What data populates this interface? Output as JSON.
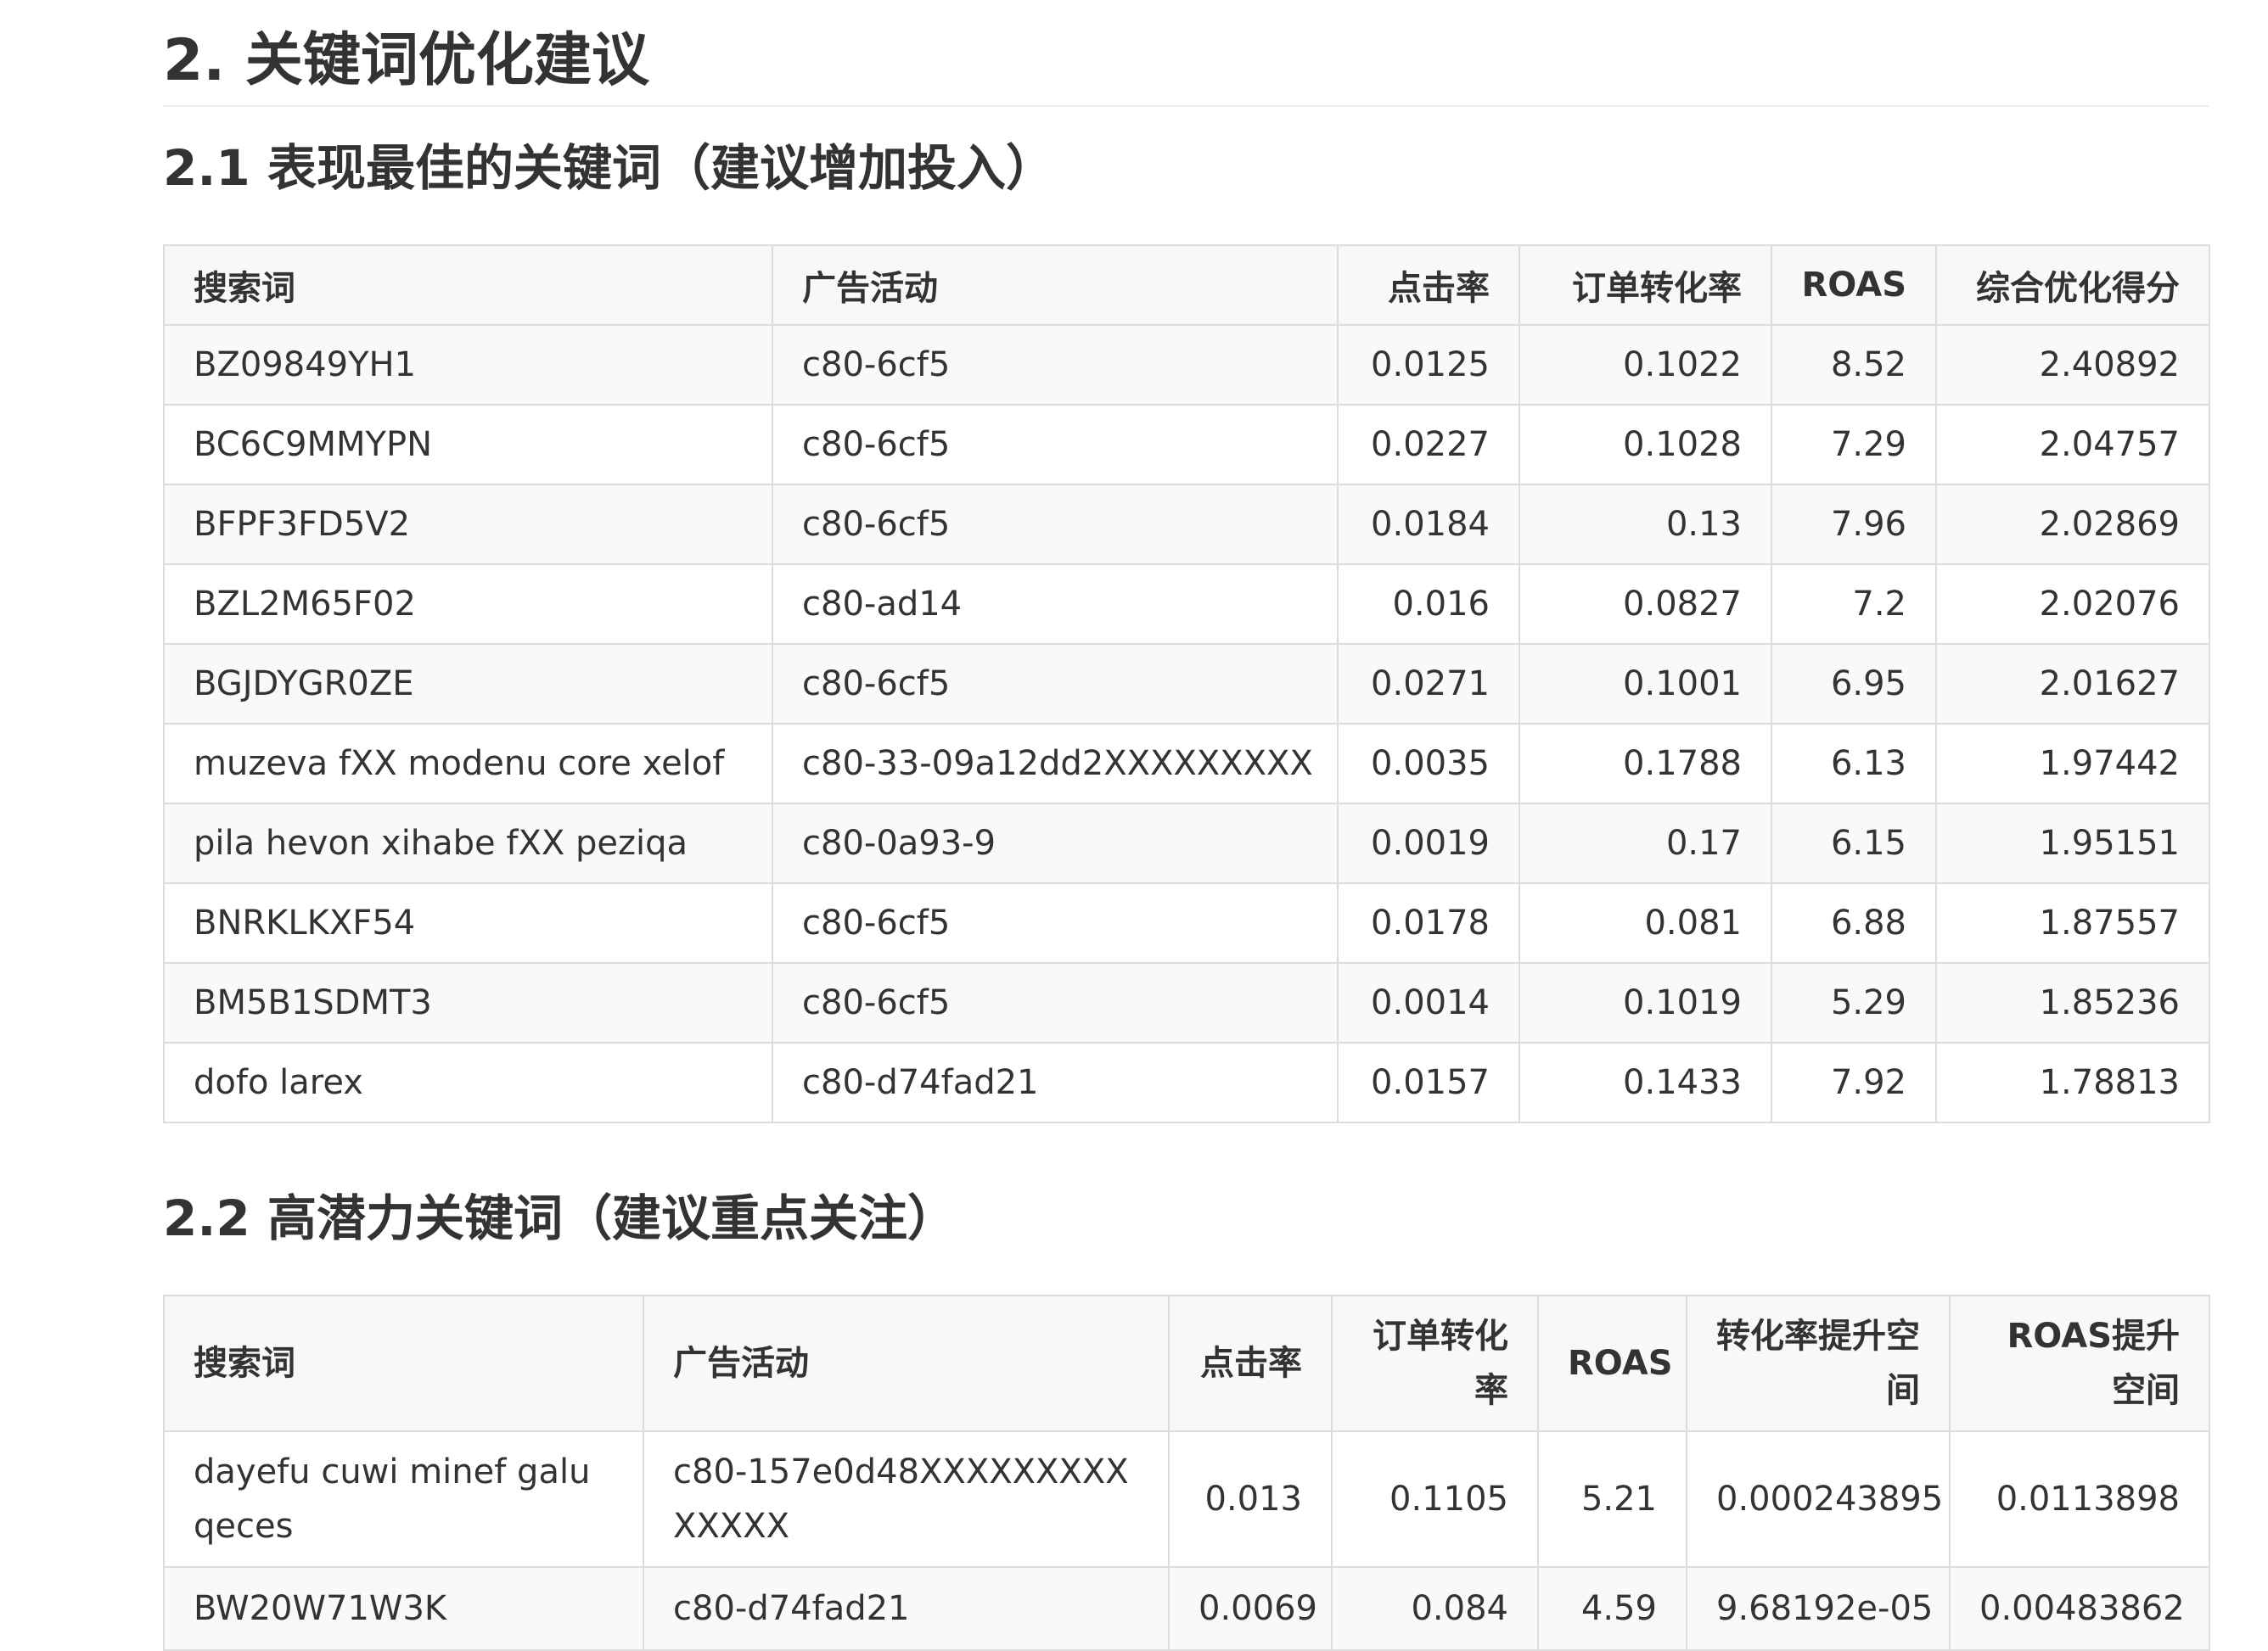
{
  "section_title": "2. 关键词优化建议",
  "subtitle_1": "2.1 表现最佳的关键词（建议增加投入）",
  "subtitle_2": "2.2 高潜力关键词（建议重点关注）",
  "table_1": {
    "headers": [
      "搜索词",
      "广告活动",
      "点击率",
      "订单转化率",
      "ROAS",
      "综合优化得分"
    ],
    "rows": [
      [
        "BZ09849YH1",
        "c80-6cf5",
        "0.0125",
        "0.1022",
        "8.52",
        "2.40892"
      ],
      [
        "BC6C9MMYPN",
        "c80-6cf5",
        "0.0227",
        "0.1028",
        "7.29",
        "2.04757"
      ],
      [
        "BFPF3FD5V2",
        "c80-6cf5",
        "0.0184",
        "0.13",
        "7.96",
        "2.02869"
      ],
      [
        "BZL2M65F02",
        "c80-ad14",
        "0.016",
        "0.0827",
        "7.2",
        "2.02076"
      ],
      [
        "BGJDYGR0ZE",
        "c80-6cf5",
        "0.0271",
        "0.1001",
        "6.95",
        "2.01627"
      ],
      [
        "muzeva fXX modenu core xelof",
        "c80-33-09a12dd2XXXXXXXXX",
        "0.0035",
        "0.1788",
        "6.13",
        "1.97442"
      ],
      [
        "pila hevon xihabe fXX peziqa",
        "c80-0a93-9",
        "0.0019",
        "0.17",
        "6.15",
        "1.95151"
      ],
      [
        "BNRKLKXF54",
        "c80-6cf5",
        "0.0178",
        "0.081",
        "6.88",
        "1.87557"
      ],
      [
        "BM5B1SDMT3",
        "c80-6cf5",
        "0.0014",
        "0.1019",
        "5.29",
        "1.85236"
      ],
      [
        "dofo larex",
        "c80-d74fad21",
        "0.0157",
        "0.1433",
        "7.92",
        "1.78813"
      ]
    ]
  },
  "table_2": {
    "headers": [
      "搜索词",
      "广告活动",
      "点击率",
      "订单转化率",
      "ROAS",
      "转化率提升空间",
      "ROAS提升空间"
    ],
    "rows": [
      [
        "dayefu cuwi minef galu qeces",
        "c80-157e0d48XXXXXXXXXXXXXX",
        "0.013",
        "0.1105",
        "5.21",
        "0.000243895",
        "0.0113898"
      ],
      [
        "BW20W71W3K",
        "c80-d74fad21",
        "0.0069",
        "0.084",
        "4.59",
        "9.68192e-05",
        "0.00483862"
      ]
    ]
  }
}
